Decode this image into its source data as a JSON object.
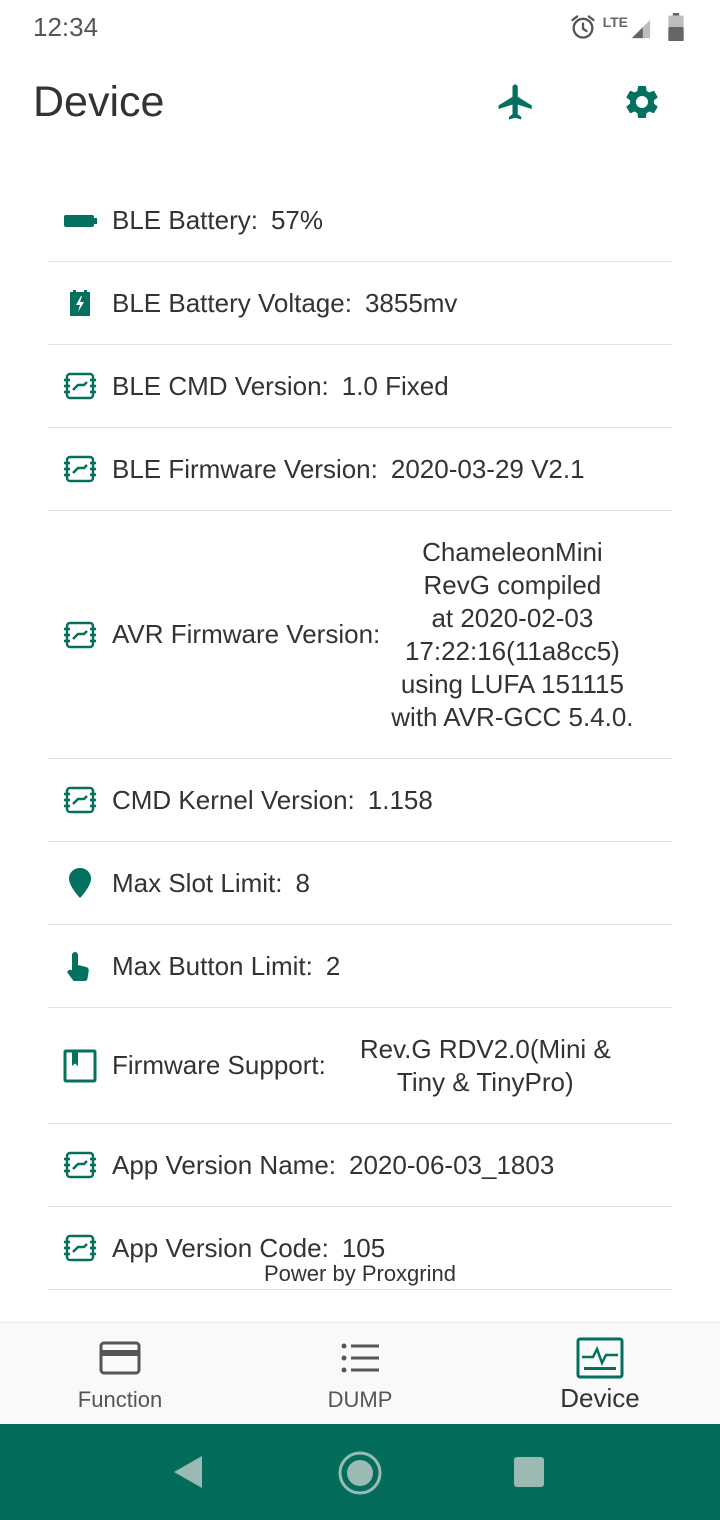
{
  "status_bar": {
    "time": "12:34",
    "network": "LTE",
    "icons": [
      "alarm-icon",
      "signal-icon",
      "battery-icon"
    ]
  },
  "app_bar": {
    "title": "Device",
    "actions": [
      "airplane-icon",
      "settings-gear-icon"
    ]
  },
  "colors": {
    "accent": "#04705e",
    "system_nav": "#046c5a",
    "divider": "#e3e3e3",
    "text": "#333333"
  },
  "info_rows": [
    {
      "icon": "battery-full-icon",
      "label": "BLE Battery:",
      "value": "57%"
    },
    {
      "icon": "battery-charging-icon",
      "label": "BLE Battery Voltage:",
      "value": "3855mv"
    },
    {
      "icon": "chip-icon",
      "label": "BLE CMD Version:",
      "value": "1.0 Fixed"
    },
    {
      "icon": "chip-icon",
      "label": "BLE Firmware Version:",
      "value": "2020-03-29 V2.1"
    },
    {
      "icon": "chip-icon",
      "label": "AVR Firmware Version:",
      "value": "ChameleonMini\nRevG compiled\nat 2020-02-03\n17:22:16(11a8cc5)\nusing LUFA 151115\nwith AVR-GCC 5.4.0."
    },
    {
      "icon": "chip-icon",
      "label": "CMD Kernel Version:",
      "value": "1.158"
    },
    {
      "icon": "map-pin-icon",
      "label": "Max Slot Limit:",
      "value": "8"
    },
    {
      "icon": "touch-hand-icon",
      "label": "Max Button Limit:",
      "value": "2"
    },
    {
      "icon": "book-icon",
      "label": "Firmware Support:",
      "value": "Rev.G RDV2.0(Mini &\nTiny & TinyPro)"
    },
    {
      "icon": "chip-icon",
      "label": "App Version Name:",
      "value": "2020-06-03_1803"
    },
    {
      "icon": "chip-icon",
      "label": "App Version Code:",
      "value": "105"
    }
  ],
  "footer": {
    "credit": "Power by Proxgrind"
  },
  "bottom_nav": {
    "items": [
      {
        "label": "Function",
        "icon": "card-icon",
        "active": false
      },
      {
        "label": "DUMP",
        "icon": "list-icon",
        "active": false
      },
      {
        "label": "Device",
        "icon": "monitor-pulse-icon",
        "active": true
      }
    ]
  },
  "system_nav": {
    "buttons": [
      "back-icon",
      "home-icon",
      "recent-apps-icon"
    ]
  }
}
